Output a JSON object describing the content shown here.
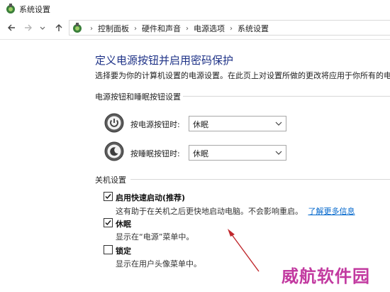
{
  "window": {
    "title": "系统设置",
    "icon": "control-panel-icon"
  },
  "nav": {
    "back_icon": "back-arrow-icon",
    "forward_icon": "forward-arrow-icon",
    "dropdown_icon": "chevron-down-icon",
    "up_icon": "up-arrow-icon"
  },
  "breadcrumb": [
    "控制面板",
    "硬件和声音",
    "电源选项",
    "系统设置"
  ],
  "page": {
    "title": "定义电源按钮并启用密码保护",
    "description": "选择要为你的计算机设置的电源设置。在此页上对设置所做的更改将应用于你所有的电"
  },
  "power_section": {
    "title": "电源按钮和睡眠按钮设置",
    "rows": [
      {
        "label": "按电源按钮时:",
        "value": "休眠",
        "icon": "power-button-icon"
      },
      {
        "label": "按睡眠按钮时:",
        "value": "休眠",
        "icon": "sleep-button-icon"
      }
    ]
  },
  "shutdown_section": {
    "title": "关机设置",
    "items": [
      {
        "label": "启用快速启动(推荐)",
        "checked": true,
        "bold": true,
        "desc": "这有助于在关机之后更快地启动电脑。不会影响重启。",
        "link": "了解更多信息"
      },
      {
        "label": "休眠",
        "checked": true,
        "bold": true,
        "desc": "显示在“电源”菜单中。"
      },
      {
        "label": "锁定",
        "checked": false,
        "bold": true,
        "desc": "显示在用户头像菜单中。"
      }
    ]
  },
  "watermark": "威航软件园",
  "colors": {
    "title_blue": "#1e3287",
    "link_blue": "#0066cc",
    "annotation_red": "#c0282d",
    "watermark": "#c23aa0"
  }
}
